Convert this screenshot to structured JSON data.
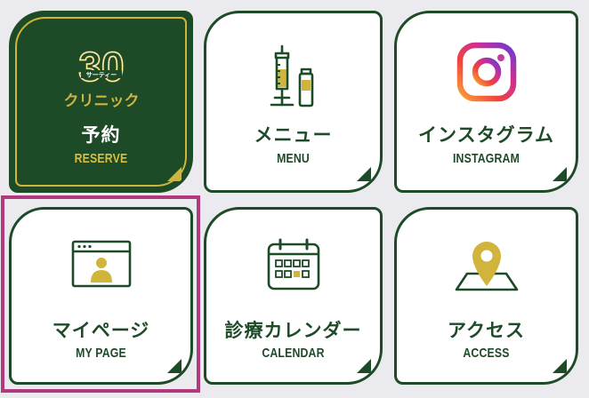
{
  "colors": {
    "page_bg": "#ebeaee",
    "brand_green": "#1d4a27",
    "brand_gold": "#d0b43c",
    "highlight": "#b03a7d"
  },
  "logo": {
    "number": "30",
    "ruby": "サーティー",
    "name": "クリニック"
  },
  "tiles": [
    {
      "key": "reserve",
      "jp": "予約",
      "en": "RESERVE",
      "icon": "clinic-logo-icon"
    },
    {
      "key": "menu",
      "jp": "メニュー",
      "en": "MENU",
      "icon": "syringe-vial-icon"
    },
    {
      "key": "instagram",
      "jp": "インスタグラム",
      "en": "INSTAGRAM",
      "icon": "instagram-icon"
    },
    {
      "key": "mypage",
      "jp": "マイページ",
      "en": "MY PAGE",
      "icon": "user-window-icon"
    },
    {
      "key": "calendar",
      "jp": "診療カレンダー",
      "en": "CALENDAR",
      "icon": "calendar-icon"
    },
    {
      "key": "access",
      "jp": "アクセス",
      "en": "ACCESS",
      "icon": "map-pin-icon"
    }
  ]
}
